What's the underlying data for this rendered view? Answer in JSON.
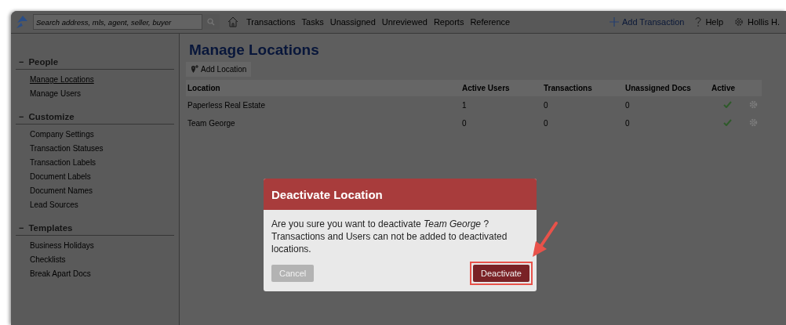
{
  "nav": {
    "search": {
      "placeholder": "Search address, mls, agent, seller, buyer"
    },
    "links": [
      "Transactions",
      "Tasks",
      "Unassigned",
      "Unreviewed",
      "Reports",
      "Reference"
    ],
    "add_transaction": "Add Transaction",
    "help": "Help",
    "user": "Hollis H."
  },
  "sidebar": {
    "sections": [
      {
        "sign": "−",
        "title": "People",
        "items": [
          {
            "label": "Manage Locations",
            "selected": true
          },
          {
            "label": "Manage Users",
            "selected": false
          }
        ]
      },
      {
        "sign": "−",
        "title": "Customize",
        "items": [
          {
            "label": "Company Settings",
            "selected": false
          },
          {
            "label": "Transaction Statuses",
            "selected": false
          },
          {
            "label": "Transaction Labels",
            "selected": false
          },
          {
            "label": "Document Labels",
            "selected": false
          },
          {
            "label": "Document Names",
            "selected": false
          },
          {
            "label": "Lead Sources",
            "selected": false
          }
        ]
      },
      {
        "sign": "−",
        "title": "Templates",
        "items": [
          {
            "label": "Business Holidays",
            "selected": false
          },
          {
            "label": "Checklists",
            "selected": false
          },
          {
            "label": "Break Apart Docs",
            "selected": false
          }
        ]
      }
    ]
  },
  "page": {
    "title": "Manage Locations",
    "add_button": "Add Location"
  },
  "table": {
    "columns": [
      "Location",
      "Active Users",
      "Transactions",
      "Unassigned Docs",
      "Active"
    ],
    "rows": [
      {
        "location": "Paperless Real Estate",
        "active_users": "1",
        "transactions": "0",
        "unassigned_docs": "0",
        "active": true
      },
      {
        "location": "Team George",
        "active_users": "0",
        "transactions": "0",
        "unassigned_docs": "0",
        "active": true
      }
    ]
  },
  "dialog": {
    "title": "Deactivate Location",
    "message_before": "Are you sure you want to deactivate",
    "name": "Team George",
    "message_after": "? Transactions and Users can not be added to deactivated locations.",
    "cancel": "Cancel",
    "confirm": "Deactivate"
  }
}
